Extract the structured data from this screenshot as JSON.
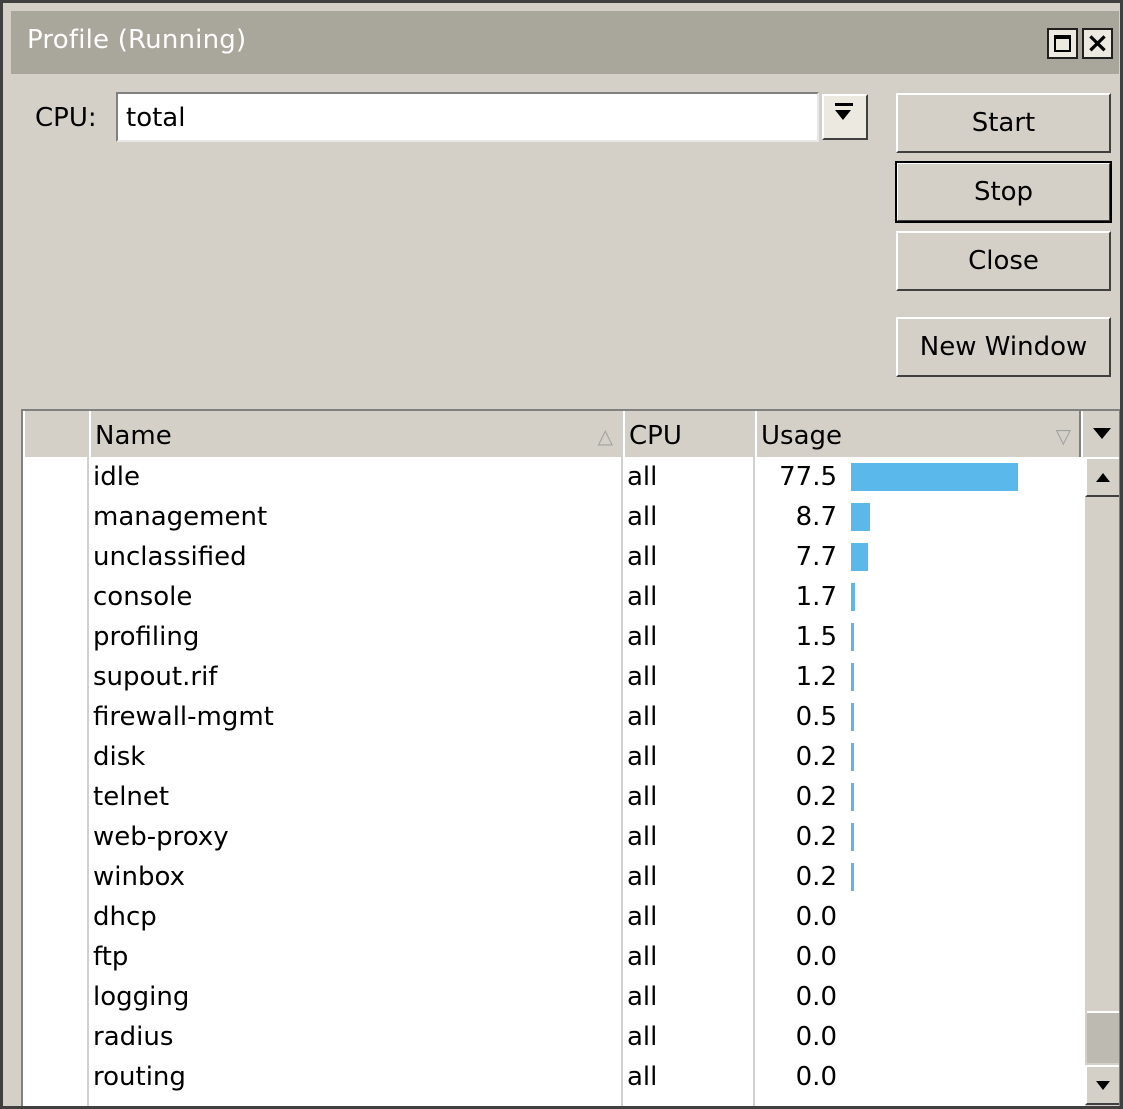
{
  "window": {
    "title": "Profile (Running)",
    "maximize_icon": "maximize-icon",
    "close_icon": "close-icon"
  },
  "cpu": {
    "label": "CPU:",
    "value": "total",
    "dropdown_icon": "dropdown-arrow-icon"
  },
  "buttons": {
    "start": "Start",
    "stop": "Stop",
    "close": "Close",
    "new_window": "New Window"
  },
  "table": {
    "columns": [
      "Name",
      "CPU",
      "Usage"
    ],
    "rows": [
      {
        "name": "idle",
        "cpu": "all",
        "usage": "77.5",
        "usage_value": 77.5
      },
      {
        "name": "management",
        "cpu": "all",
        "usage": "8.7",
        "usage_value": 8.7
      },
      {
        "name": "unclassified",
        "cpu": "all",
        "usage": "7.7",
        "usage_value": 7.7
      },
      {
        "name": "console",
        "cpu": "all",
        "usage": "1.7",
        "usage_value": 1.7
      },
      {
        "name": "profiling",
        "cpu": "all",
        "usage": "1.5",
        "usage_value": 1.5
      },
      {
        "name": "supout.rif",
        "cpu": "all",
        "usage": "1.2",
        "usage_value": 1.2
      },
      {
        "name": "firewall-mgmt",
        "cpu": "all",
        "usage": "0.5",
        "usage_value": 0.5
      },
      {
        "name": "disk",
        "cpu": "all",
        "usage": "0.2",
        "usage_value": 0.2
      },
      {
        "name": "telnet",
        "cpu": "all",
        "usage": "0.2",
        "usage_value": 0.2
      },
      {
        "name": "web-proxy",
        "cpu": "all",
        "usage": "0.2",
        "usage_value": 0.2
      },
      {
        "name": "winbox",
        "cpu": "all",
        "usage": "0.2",
        "usage_value": 0.2
      },
      {
        "name": "dhcp",
        "cpu": "all",
        "usage": "0.0",
        "usage_value": 0.0
      },
      {
        "name": "ftp",
        "cpu": "all",
        "usage": "0.0",
        "usage_value": 0.0
      },
      {
        "name": "logging",
        "cpu": "all",
        "usage": "0.0",
        "usage_value": 0.0
      },
      {
        "name": "radius",
        "cpu": "all",
        "usage": "0.0",
        "usage_value": 0.0
      },
      {
        "name": "routing",
        "cpu": "all",
        "usage": "0.0",
        "usage_value": 0.0
      }
    ]
  },
  "colors": {
    "usage_bar": "#5ab8ea",
    "titlebar": "#a9a69c",
    "window_bg": "#d4d0c8"
  }
}
